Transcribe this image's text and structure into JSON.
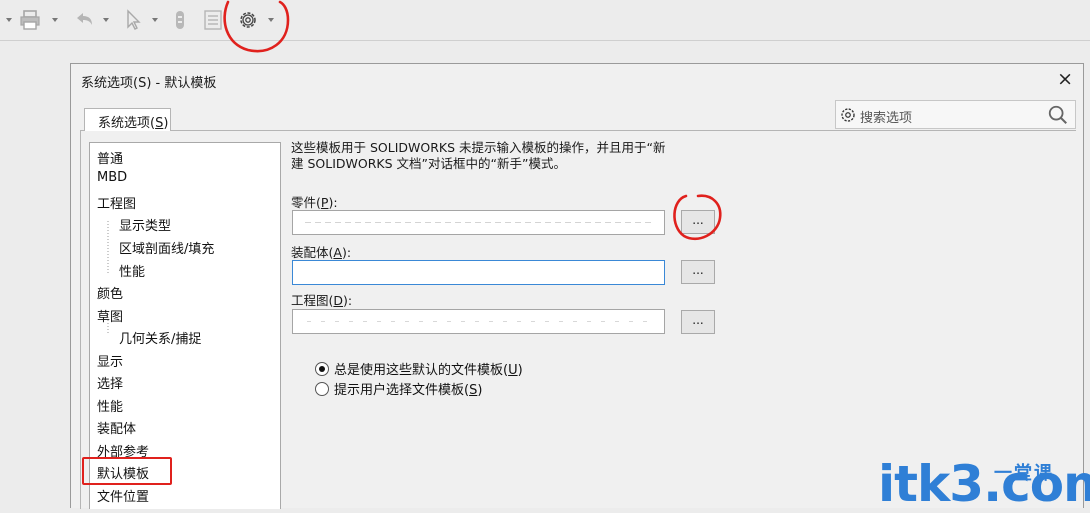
{
  "toolbar": {
    "icons": [
      "print-icon",
      "undo-icon",
      "select-pointer-icon",
      "part-icon",
      "list-icon",
      "gear-icon"
    ],
    "accent_red": "#e0211d"
  },
  "dialog": {
    "title": "系统选项(S) - 默认模板",
    "close": "×",
    "tab_label": "系统选项",
    "tab_shortcut": "S",
    "search_placeholder": "搜索选项"
  },
  "tree": {
    "items": [
      "普通",
      "MBD",
      "工程图",
      "显示类型",
      "区域剖面线/填充",
      "性能",
      "颜色",
      "草图",
      "几何关系/捕捉",
      "显示",
      "选择",
      "性能",
      "装配体",
      "外部参考",
      "默认模板",
      "文件位置"
    ],
    "selected": "默认模板"
  },
  "main": {
    "description_line1": "这些模板用于 SOLIDWORKS 未提示输入模板的操作，并且用于“新",
    "description_line2": "建 SOLIDWORKS 文档”对话框中的“新手”模式。",
    "part_label": "零件",
    "part_key": "P",
    "assembly_label": "装配体",
    "assembly_key": "A",
    "drawing_label": "工程图",
    "drawing_key": "D",
    "browse": "...",
    "radio_always": "总是使用这些默认的文件模板",
    "radio_always_key": "U",
    "radio_prompt": "提示用户选择文件模板",
    "radio_prompt_key": "S",
    "radio_selected": "always"
  },
  "watermark": {
    "main": "itk3",
    "suffix": ".com",
    "cn": "一堂课"
  }
}
